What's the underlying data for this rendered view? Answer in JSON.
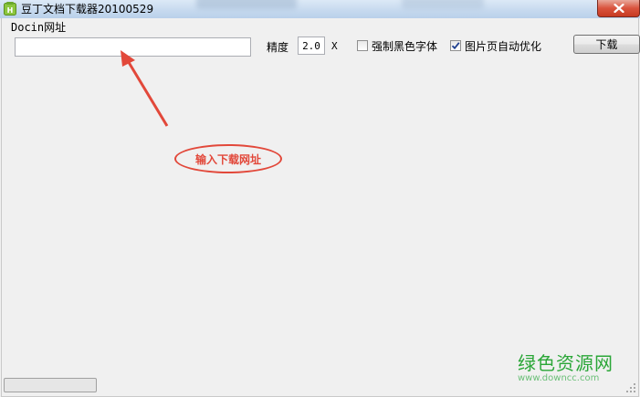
{
  "window": {
    "title": "豆丁文档下载器20100529",
    "icon": "app-logo-icon",
    "close_icon": "close-icon"
  },
  "form": {
    "url_label": "Docin网址",
    "url_value": "",
    "precision_label": "精度",
    "precision_value": "2.0",
    "precision_unit": "X",
    "force_black_font": {
      "label": "强制黑色字体",
      "checked": false
    },
    "image_page_optimize": {
      "label": "图片页自动优化",
      "checked": true
    },
    "download_button": "下载"
  },
  "annotation": {
    "text": "输入下载网址",
    "color": "#e2483a"
  },
  "watermark": {
    "main": "绿色资源网",
    "url": "www.downcc.com",
    "color": "#2aa637"
  },
  "statusbar": {
    "progress": 0
  }
}
